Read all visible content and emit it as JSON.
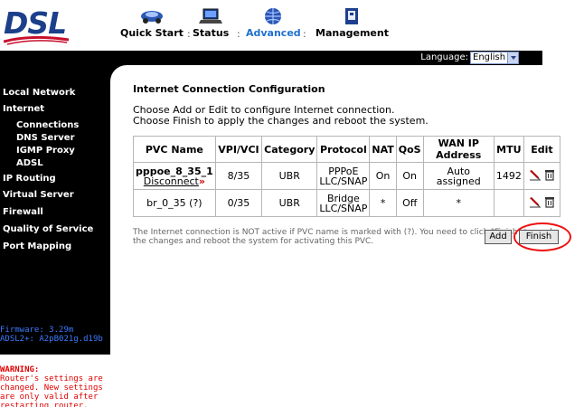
{
  "header": {
    "logo": "DSL",
    "nav": [
      {
        "label": "Quick Start",
        "icon": "car-icon"
      },
      {
        "label": "Status",
        "icon": "laptop-icon"
      },
      {
        "label": "Advanced",
        "icon": "globe-icon"
      },
      {
        "label": "Management",
        "icon": "book-icon"
      }
    ],
    "separator": ":",
    "accent": "#1e6fd0"
  },
  "language": {
    "label": "Language:",
    "selected": "English"
  },
  "sidebar": {
    "items": [
      {
        "label": "Local Network"
      },
      {
        "label": "Internet"
      },
      {
        "label": "Connections"
      },
      {
        "label": "DNS Server"
      },
      {
        "label": "IGMP Proxy"
      },
      {
        "label": "ADSL"
      },
      {
        "label": "IP Routing"
      },
      {
        "label": "Virtual Server"
      },
      {
        "label": "Firewall"
      },
      {
        "label": "Quality of Service"
      },
      {
        "label": "Port Mapping"
      }
    ],
    "firmware": "Firmware: 3.29m",
    "adsl": "ADSL2+: A2pB021g.d19b"
  },
  "warning": {
    "title": "WARNING:",
    "body": "Router's settings are changed. New settings are only valid after restarting router."
  },
  "main": {
    "title": "Internet Connection Configuration",
    "instructions": [
      "Choose Add or Edit to configure Internet connection.",
      "Choose Finish to apply the changes and reboot the system."
    ],
    "table": {
      "headers": [
        "PVC Name",
        "VPI/VCI",
        "Category",
        "Protocol",
        "NAT",
        "QoS",
        "WAN IP Address",
        "MTU",
        "Edit"
      ],
      "rows": [
        {
          "name": "pppoe_8_35_1",
          "action": "Disconnect",
          "vpivci": "8/35",
          "category": "UBR",
          "protocol": "PPPoE LLC/SNAP",
          "nat": "On",
          "qos": "On",
          "wan": "Auto assigned",
          "mtu": "1492"
        },
        {
          "name": "br_0_35 (?)",
          "action": "",
          "vpivci": "0/35",
          "category": "UBR",
          "protocol": "Bridge LLC/SNAP",
          "nat": "*",
          "qos": "Off",
          "wan": "*",
          "mtu": ""
        }
      ]
    },
    "note": "The Internet connection is NOT active if PVC name is marked with (?). You need to click \"Finish\" to apply the changes and reboot the system for activating this PVC.",
    "add_label": "Add",
    "finish_label": "Finish"
  }
}
